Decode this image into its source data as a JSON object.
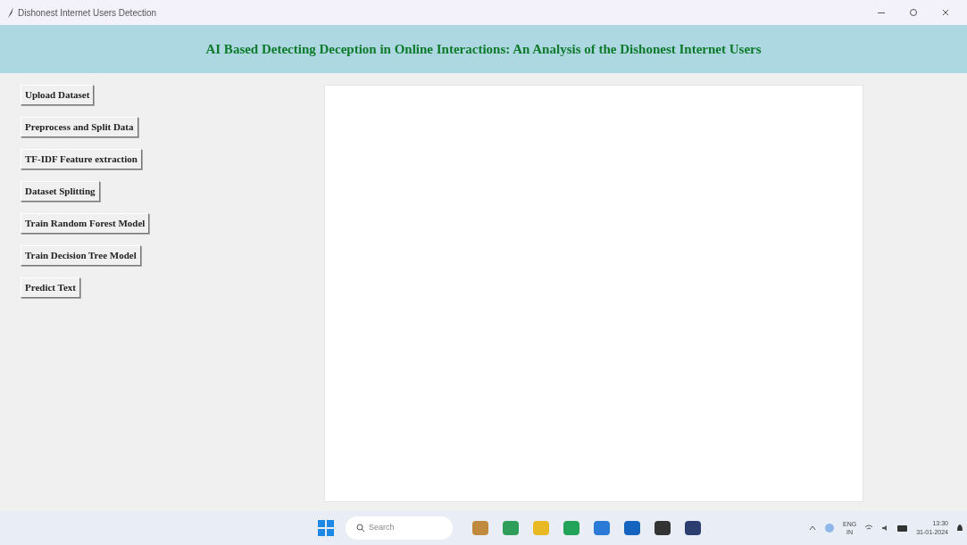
{
  "window": {
    "title": "Dishonest Internet Users Detection"
  },
  "header": {
    "title": "AI Based Detecting Deception in Online Interactions: An Analysis of the Dishonest Internet Users"
  },
  "buttons": [
    "Upload Dataset",
    "Preprocess and Split Data",
    "TF-IDF Feature extraction",
    "Dataset Splitting",
    "Train Random Forest Model",
    "Train Decision Tree Model",
    "Predict Text"
  ],
  "taskbar": {
    "search_placeholder": "Search",
    "language": "ENG",
    "region": "IN",
    "time": "13:30",
    "date": "31-01-2024"
  }
}
